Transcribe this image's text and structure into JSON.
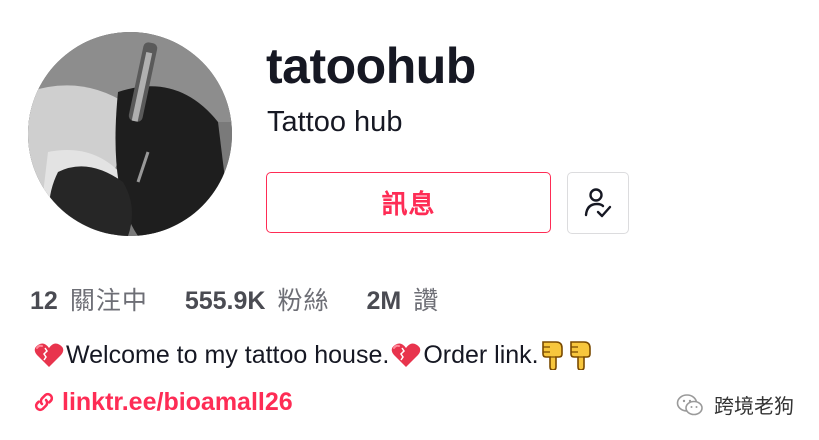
{
  "profile": {
    "username": "tatoohub",
    "nickname": "Tattoo hub",
    "message_button": "訊息"
  },
  "stats": {
    "following_count": "12",
    "following_label": "關注中",
    "followers_count": "555.9K",
    "followers_label": "粉絲",
    "likes_count": "2M",
    "likes_label": "讚"
  },
  "bio": {
    "part1": "Welcome to my tattoo house.",
    "part2": "Order link.",
    "emojis": [
      "heart-emoji",
      "heart-emoji",
      "pointing-down-emoji",
      "pointing-down-emoji"
    ]
  },
  "link": {
    "text": "linktr.ee/bioamall26"
  },
  "watermark": {
    "text": "跨境老狗",
    "icon": "wechat-icon"
  },
  "colors": {
    "accent": "#fe2c55",
    "text": "#161823",
    "secondary": "#6d6e75"
  }
}
